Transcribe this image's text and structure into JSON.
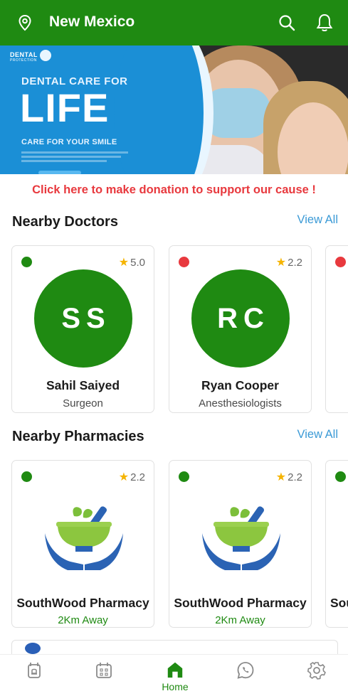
{
  "header": {
    "title": "New Mexico",
    "icons": [
      "location-pin-icon",
      "search-icon",
      "bell-icon"
    ],
    "background": "#1f8a12"
  },
  "banner": {
    "brand": "DENTAL",
    "brand_sub": "PROTECTION",
    "line1": "DENTAL CARE FOR",
    "line2": "LIFE",
    "line3": "CARE FOR YOUR SMILE"
  },
  "donate_text": "Click here to make donation to support our cause !",
  "doctors": {
    "title": "Nearby Doctors",
    "view_all": "View All",
    "items": [
      {
        "initials": "SS",
        "name": "Sahil Saiyed",
        "specialty": "Surgeon",
        "rating": "5.0",
        "status_color": "#1f8a12"
      },
      {
        "initials": "RC",
        "name": "Ryan Cooper",
        "specialty": "Anesthesiologists",
        "rating": "2.2",
        "status_color": "#e8393e"
      }
    ],
    "partial_status_color": "#e8393e"
  },
  "pharmacies": {
    "title": "Nearby Pharmacies",
    "view_all": "View All",
    "items": [
      {
        "name": "SouthWood Pharmacy",
        "distance": "2Km Away",
        "rating": "2.2",
        "status_color": "#1f8a12"
      },
      {
        "name": "SouthWood Pharmacy",
        "distance": "2Km Away",
        "rating": "2.2",
        "status_color": "#1f8a12"
      }
    ],
    "partial_name": "Sou",
    "partial_status_color": "#1f8a12"
  },
  "bottom_nav": {
    "items": [
      {
        "icon": "alarm-icon",
        "label": ""
      },
      {
        "icon": "calendar-icon",
        "label": ""
      },
      {
        "icon": "home-icon",
        "label": "Home",
        "active": true
      },
      {
        "icon": "whatsapp-icon",
        "label": ""
      },
      {
        "icon": "settings-gear-icon",
        "label": ""
      }
    ]
  },
  "colors": {
    "primary": "#1f8a12",
    "accent_link": "#3b9ad6",
    "alert": "#e8393e",
    "inactive_icon": "#8a8a8a"
  }
}
